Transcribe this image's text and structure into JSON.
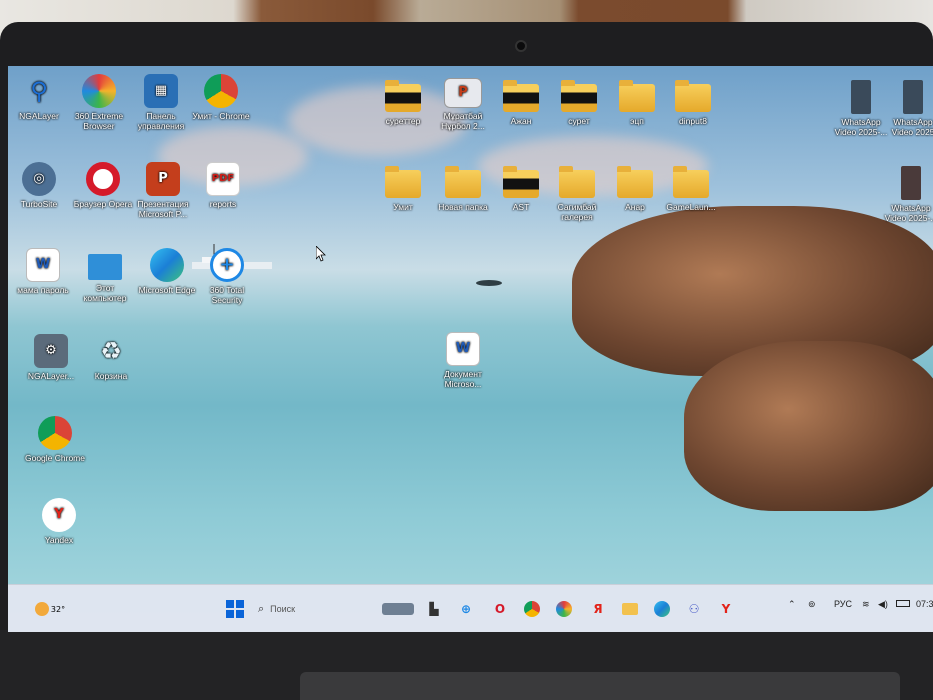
{
  "desktop": {
    "icons_left": [
      {
        "label": "NGALayer",
        "icon": "ngalayer-icon"
      },
      {
        "label": "360 Extreme Browser",
        "icon": "360-browser-icon"
      },
      {
        "label": "Панель управления",
        "icon": "control-panel-icon"
      },
      {
        "label": "Умит - Chrome",
        "icon": "chrome-profile-icon"
      },
      {
        "label": "TurboSite",
        "icon": "turbosite-icon"
      },
      {
        "label": "Браузер Opera",
        "icon": "opera-icon"
      },
      {
        "label": "Презентация Microsoft P...",
        "icon": "powerpoint-icon"
      },
      {
        "label": "reports",
        "icon": "pdf-icon"
      },
      {
        "label": "мама пароль",
        "icon": "word-icon"
      },
      {
        "label": "Этот компьютер",
        "icon": "computer-icon"
      },
      {
        "label": "Microsoft Edge",
        "icon": "edge-icon"
      },
      {
        "label": "360 Total Security",
        "icon": "360-security-icon"
      },
      {
        "label": "NGALayer...",
        "icon": "installer-icon"
      },
      {
        "label": "Корзина",
        "icon": "recycle-bin-icon"
      },
      {
        "label": "Google Chrome",
        "icon": "chrome-icon"
      },
      {
        "label": "Yandex",
        "icon": "yandex-icon"
      }
    ],
    "icons_top": [
      {
        "label": "суреттер",
        "icon": "folder-icon"
      },
      {
        "label": "Мұратбай Нұрбол 2...",
        "icon": "ppt-file-icon"
      },
      {
        "label": "Ажан",
        "icon": "folder-icon"
      },
      {
        "label": "сурет",
        "icon": "folder-icon"
      },
      {
        "label": "эцп",
        "icon": "folder-icon"
      },
      {
        "label": "dinput8",
        "icon": "folder-icon"
      },
      {
        "label": "Умит",
        "icon": "folder-icon"
      },
      {
        "label": "Новая папка",
        "icon": "folder-icon"
      },
      {
        "label": "AST",
        "icon": "folder-icon"
      },
      {
        "label": "Сагимбай галерея",
        "icon": "folder-icon"
      },
      {
        "label": "Анар",
        "icon": "folder-icon"
      },
      {
        "label": "GameLaun...",
        "icon": "folder-icon"
      }
    ],
    "doc_icon": {
      "label": "Документ Microso...",
      "icon": "word-doc-icon"
    },
    "icons_right": [
      {
        "label": "WhatsApp Video 2025-...",
        "icon": "video-icon"
      },
      {
        "label": "WhatsApp Video 2025",
        "icon": "video-icon"
      },
      {
        "label": "WhatsApp Video 2025-...",
        "icon": "video-icon"
      }
    ]
  },
  "taskbar": {
    "weather": "32°",
    "search_placeholder": "Поиск",
    "lang": "РУС",
    "time": "07:3"
  },
  "colors": {
    "accent": "#0a64d8",
    "taskbar": "#e1e6f0"
  }
}
